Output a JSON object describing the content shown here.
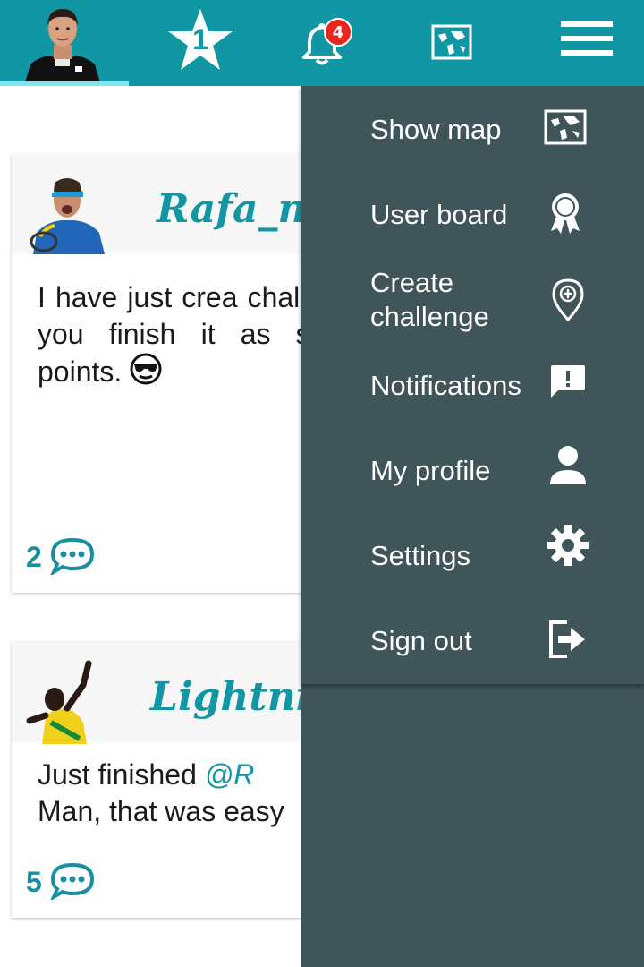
{
  "topbar": {
    "star_rank": "1",
    "notification_badge": "4",
    "icons": [
      "user-avatar",
      "star-icon",
      "bell-icon",
      "map-icon",
      "hamburger-menu-icon"
    ],
    "accent_color": "#1197a4"
  },
  "feed": {
    "posts": [
      {
        "username": "Rafa_no",
        "text": "I have just crea challenge for you finish it as soon as points.",
        "emoji": "sunglasses-emoji",
        "comment_count": "2"
      },
      {
        "username": "Lightning",
        "text_before_mention": "Just finished ",
        "mention": "@R",
        "text_after_mention": "Man, that was easy",
        "comment_count": "5"
      }
    ]
  },
  "menu": {
    "items": [
      {
        "label": "Show map",
        "icon": "map-icon"
      },
      {
        "label": "User board",
        "icon": "award-icon"
      },
      {
        "label_line1": "Create",
        "label_line2": "challenge",
        "icon": "location-pin-add-icon"
      },
      {
        "label": "Notifications",
        "icon": "feedback-icon"
      },
      {
        "label": "My profile",
        "icon": "person-icon"
      },
      {
        "label": "Settings",
        "icon": "gear-icon"
      },
      {
        "label": "Sign out",
        "icon": "exit-icon"
      }
    ],
    "background_color": "#3f5559"
  }
}
